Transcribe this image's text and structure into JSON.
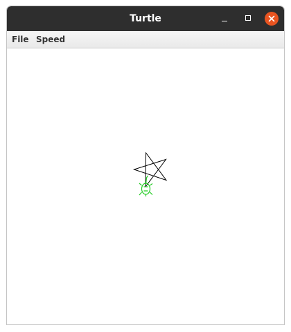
{
  "window": {
    "title": "Turtle"
  },
  "menu": {
    "items": [
      {
        "label": "File"
      },
      {
        "label": "Speed"
      }
    ]
  },
  "canvas": {
    "drawing": "five-pointed star",
    "pen_color": "#000000",
    "turtle_color": "#22cc22"
  },
  "colors": {
    "titlebar": "#2e2e2e",
    "close_button": "#e95420",
    "menubar": "#eeeeee"
  },
  "icons": [
    "minimize-icon",
    "maximize-icon",
    "close-icon",
    "turtle-icon"
  ]
}
